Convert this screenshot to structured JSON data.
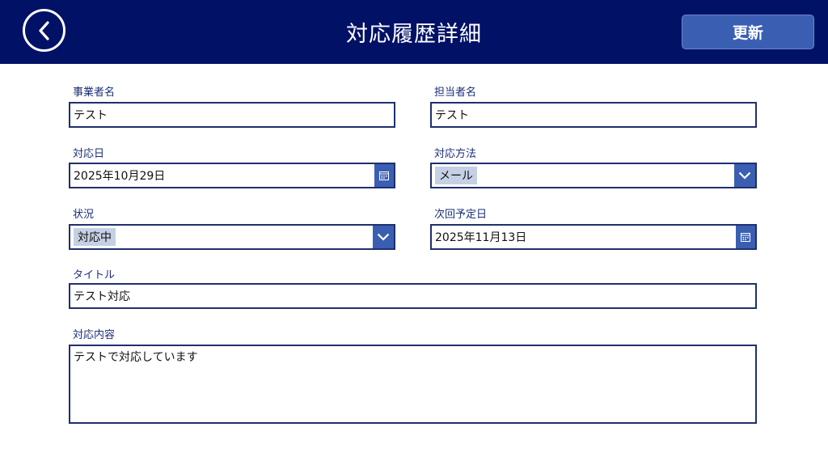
{
  "header": {
    "title": "対応履歴詳細",
    "update_label": "更新",
    "background": "#001166",
    "button_color": "#3a5fb2"
  },
  "form": {
    "business_name": {
      "label": "事業者名",
      "value": "テスト"
    },
    "person_in_charge": {
      "label": "担当者名",
      "value": "テスト"
    },
    "response_date": {
      "label": "対応日",
      "value": "2025年10月29日"
    },
    "response_method": {
      "label": "対応方法",
      "value": "メール"
    },
    "status": {
      "label": "状況",
      "value": "対応中"
    },
    "next_scheduled_date": {
      "label": "次回予定日",
      "value": "2025年11月13日"
    },
    "title_field": {
      "label": "タイトル",
      "value": "テスト対応"
    },
    "content": {
      "label": "対応内容",
      "value": "テストで対応しています"
    }
  },
  "icons": {
    "back": "chevron-left-icon",
    "calendar": "calendar-icon",
    "dropdown": "chevron-down-icon"
  }
}
